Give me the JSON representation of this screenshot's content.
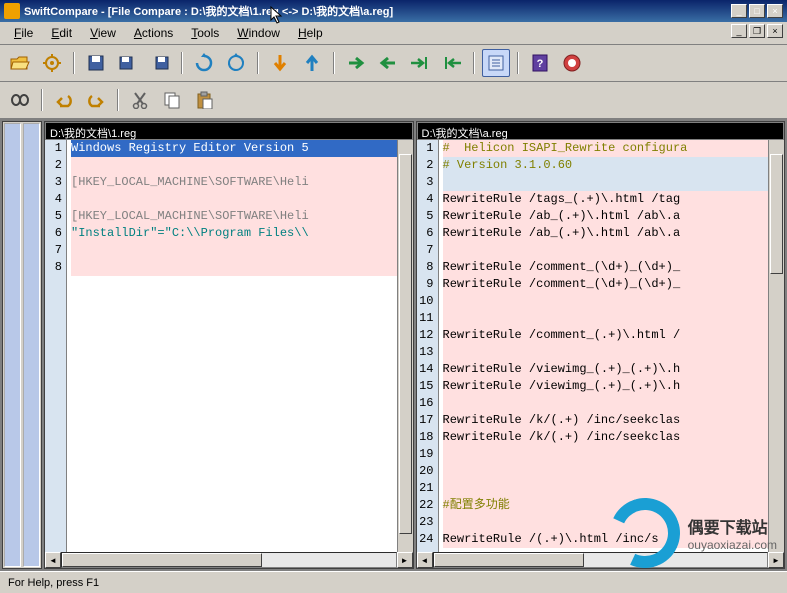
{
  "title": "SwiftCompare - [File Compare :  D:\\我的文档\\1.reg  <->  D:\\我的文档\\a.reg]",
  "menu": {
    "file": "File",
    "edit": "Edit",
    "view": "View",
    "actions": "Actions",
    "tools": "Tools",
    "window": "Window",
    "help": "Help"
  },
  "icons": {
    "open": "folder-open-icon",
    "settings": "gear-icon",
    "save_all": "save-all-icon",
    "save_left": "save-left-icon",
    "save_right": "save-right-icon",
    "refresh": "refresh-icon",
    "refresh_all": "refresh-all-icon",
    "down": "arrow-down-icon",
    "up": "arrow-up-icon",
    "copy_right": "copy-right-icon",
    "copy_left": "copy-left-icon",
    "copy_right2": "copy-right2-icon",
    "copy_left2": "copy-left2-icon",
    "list": "list-icon",
    "help": "help-icon",
    "about": "about-icon",
    "search": "binoculars-icon",
    "undo": "undo-icon",
    "redo": "redo-icon",
    "cut": "cut-icon",
    "copy": "copy-icon",
    "paste": "paste-icon"
  },
  "left": {
    "path": "D:\\我的文档\\1.reg",
    "lines": [
      {
        "n": "1",
        "cls": "sel",
        "t": "Windows Registry Editor Version 5"
      },
      {
        "n": "2",
        "cls": "diff",
        "t": ""
      },
      {
        "n": "3",
        "cls": "diff",
        "t": "[HKEY_LOCAL_MACHINE\\SOFTWARE\\Heli"
      },
      {
        "n": "4",
        "cls": "diff",
        "t": ""
      },
      {
        "n": "5",
        "cls": "diff",
        "t": "[HKEY_LOCAL_MACHINE\\SOFTWARE\\Heli"
      },
      {
        "n": "6",
        "cls": "diff",
        "t": "\"InstallDir\"=\"C:\\\\Program Files\\\\"
      },
      {
        "n": "7",
        "cls": "diff",
        "t": ""
      },
      {
        "n": "8",
        "cls": "diff",
        "t": ""
      }
    ]
  },
  "right": {
    "path": "D:\\我的文档\\a.reg",
    "lines": [
      {
        "n": "1",
        "cls": "diff",
        "t": "#  Helicon ISAPI_Rewrite configura",
        "cmt": true
      },
      {
        "n": "2",
        "cls": "same",
        "t": "# Version 3.1.0.60",
        "cmt": true
      },
      {
        "n": "3",
        "cls": "same",
        "t": ""
      },
      {
        "n": "4",
        "cls": "diff",
        "t": "RewriteRule /tags_(.+)\\.html /tag"
      },
      {
        "n": "5",
        "cls": "diff",
        "t": "RewriteRule /ab_(.+)\\.html /ab\\.a"
      },
      {
        "n": "6",
        "cls": "diff",
        "t": "RewriteRule /ab_(.+)\\.html /ab\\.a"
      },
      {
        "n": "7",
        "cls": "diff",
        "t": ""
      },
      {
        "n": "8",
        "cls": "diff",
        "t": "RewriteRule /comment_(\\d+)_(\\d+)_"
      },
      {
        "n": "9",
        "cls": "diff",
        "t": "RewriteRule /comment_(\\d+)_(\\d+)_"
      },
      {
        "n": "10",
        "cls": "diff",
        "t": ""
      },
      {
        "n": "11",
        "cls": "diff",
        "t": ""
      },
      {
        "n": "12",
        "cls": "diff",
        "t": "RewriteRule /comment_(.+)\\.html /"
      },
      {
        "n": "13",
        "cls": "diff",
        "t": ""
      },
      {
        "n": "14",
        "cls": "diff",
        "t": "RewriteRule /viewimg_(.+)_(.+)\\.h"
      },
      {
        "n": "15",
        "cls": "diff",
        "t": "RewriteRule /viewimg_(.+)_(.+)\\.h"
      },
      {
        "n": "16",
        "cls": "diff",
        "t": ""
      },
      {
        "n": "17",
        "cls": "diff",
        "t": "RewriteRule /k/(.+) /inc/seekclas"
      },
      {
        "n": "18",
        "cls": "diff",
        "t": "RewriteRule /k/(.+) /inc/seekclas"
      },
      {
        "n": "19",
        "cls": "diff",
        "t": ""
      },
      {
        "n": "20",
        "cls": "diff",
        "t": ""
      },
      {
        "n": "21",
        "cls": "diff",
        "t": ""
      },
      {
        "n": "22",
        "cls": "diff",
        "t": "#配置多功能",
        "cmt": true
      },
      {
        "n": "23",
        "cls": "diff",
        "t": ""
      },
      {
        "n": "24",
        "cls": "diff",
        "t": "RewriteRule /(.+)\\.html /inc/s"
      }
    ]
  },
  "status": "For Help, press F1",
  "watermark": {
    "title": "偶要下载站",
    "sub": "ouyaoxiazai.com"
  }
}
